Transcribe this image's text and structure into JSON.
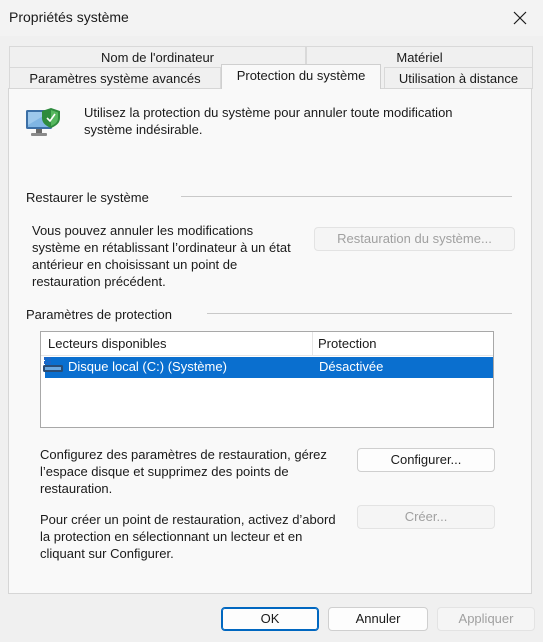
{
  "window": {
    "title": "Propriétés système"
  },
  "tabs": {
    "back": [
      {
        "label": "Nom de l'ordinateur"
      },
      {
        "label": "Matériel"
      }
    ],
    "front": [
      {
        "label": "Paramètres système avancés"
      },
      {
        "label": "Protection du système"
      },
      {
        "label": "Utilisation à distance"
      }
    ],
    "active": "Protection du système"
  },
  "intro": {
    "line1": "Utilisez la protection du système pour annuler toute modification",
    "line2": "système indésirable."
  },
  "restore": {
    "heading": "Restaurer le système",
    "lines": [
      "Vous pouvez annuler les modifications",
      "système en rétablissant l’ordinateur à un état",
      "antérieur en choisissant un point de",
      "restauration précédent."
    ],
    "button": "Restauration du système..."
  },
  "protection": {
    "heading": "Paramètres de protection",
    "columns": [
      "Lecteurs disponibles",
      "Protection"
    ],
    "rows": [
      {
        "drive": "Disque local (C:) (Système)",
        "status": "Désactivée",
        "selected": true
      }
    ],
    "configure_lines": [
      "Configurez des paramètres de restauration, gérez",
      "l’espace disque et supprimez des points de",
      "restauration."
    ],
    "configure_button": "Configurer...",
    "create_lines": [
      "Pour créer un point de restauration, activez d’abord",
      "la protection en sélectionnant un lecteur et en",
      "cliquant sur Configurer."
    ],
    "create_button": "Créer..."
  },
  "footer": {
    "ok": "OK",
    "cancel": "Annuler",
    "apply": "Appliquer"
  },
  "colors": {
    "selection": "#0a6fcf",
    "accent": "#0067c0",
    "disabled_text": "#a0a0a0"
  },
  "icons": {
    "intro": "computer-shield-icon",
    "drive": "drive-icon",
    "close": "close-icon"
  }
}
